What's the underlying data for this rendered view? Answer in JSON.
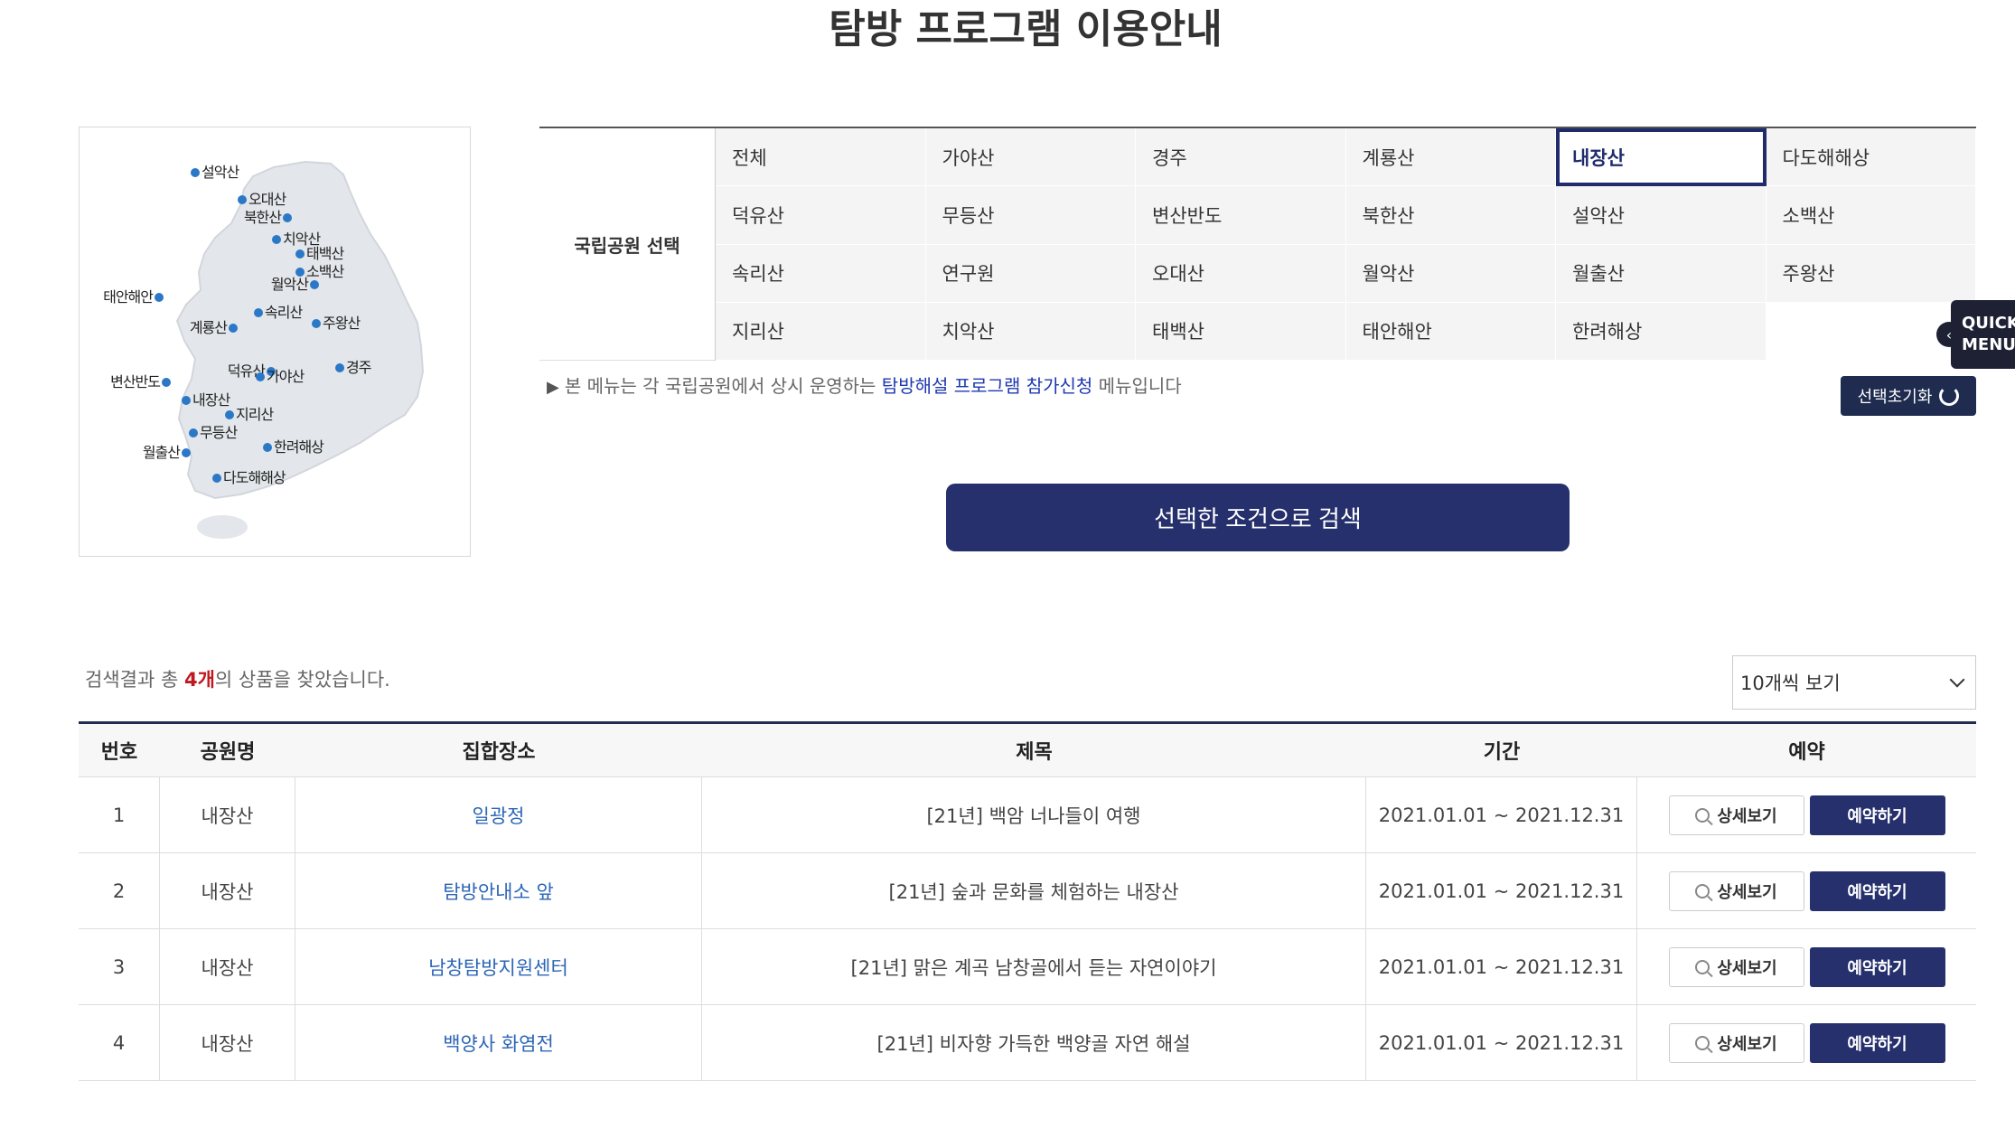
{
  "page": {
    "title": "탐방 프로그램 이용안내"
  },
  "map": {
    "labels": [
      "설악산",
      "오대산",
      "북한산",
      "치악산",
      "태백산",
      "소백산",
      "월악산",
      "태안해안",
      "속리산",
      "주왕산",
      "계룡산",
      "경주",
      "덕유산",
      "가야산",
      "변산반도",
      "내장산",
      "지리산",
      "무등산",
      "한려해상",
      "월출산",
      "다도해해상"
    ]
  },
  "park_filter": {
    "label": "국립공원 선택",
    "cells": [
      "전체",
      "가야산",
      "경주",
      "계룡산",
      "내장산",
      "다도해해상",
      "덕유산",
      "무등산",
      "변산반도",
      "북한산",
      "설악산",
      "소백산",
      "속리산",
      "연구원",
      "오대산",
      "월악산",
      "월출산",
      "주왕산",
      "지리산",
      "치악산",
      "태백산",
      "태안해안",
      "한려해상",
      ""
    ],
    "selected": "내장산"
  },
  "notice": {
    "arrow": "▶",
    "prefix": "본 메뉴는 각 국립공원에서 상시 운영하는",
    "highlight": "탐방해설 프로그램 참가신청",
    "suffix": "메뉴입니다"
  },
  "reset_button": "선택초기화",
  "quick_menu": {
    "line1": "QUICK",
    "line2": "MENU",
    "arrow": "‹"
  },
  "search_button": "선택한 조건으로 검색",
  "result": {
    "prefix": "검색결과 총",
    "count": "4개",
    "suffix": "의 상품을 찾았습니다."
  },
  "per_page": "10개씩 보기",
  "table": {
    "headers": [
      "번호",
      "공원명",
      "집합장소",
      "제목",
      "기간",
      "예약"
    ],
    "rows": [
      {
        "no": "1",
        "park": "내장산",
        "place": "일광정",
        "title": "[21년] 백암 너나들이 여행",
        "period": "2021.01.01 ~ 2021.12.31"
      },
      {
        "no": "2",
        "park": "내장산",
        "place": "탐방안내소 앞",
        "title": "[21년] 숲과 문화를 체험하는 내장산",
        "period": "2021.01.01 ~ 2021.12.31"
      },
      {
        "no": "3",
        "park": "내장산",
        "place": "남창탐방지원센터",
        "title": "[21년] 맑은 계곡 남창골에서 듣는 자연이야기",
        "period": "2021.01.01 ~ 2021.12.31"
      },
      {
        "no": "4",
        "park": "내장산",
        "place": "백양사 화염전",
        "title": "[21년] 비자향 가득한 백양골 자연 해설",
        "period": "2021.01.01 ~ 2021.12.31"
      }
    ],
    "detail_label": "상세보기",
    "book_label": "예약하기"
  },
  "colors": {
    "primary": "#26306d",
    "dot": "#2b78c7",
    "count_red": "#c0181f",
    "link": "#2c66b6"
  }
}
